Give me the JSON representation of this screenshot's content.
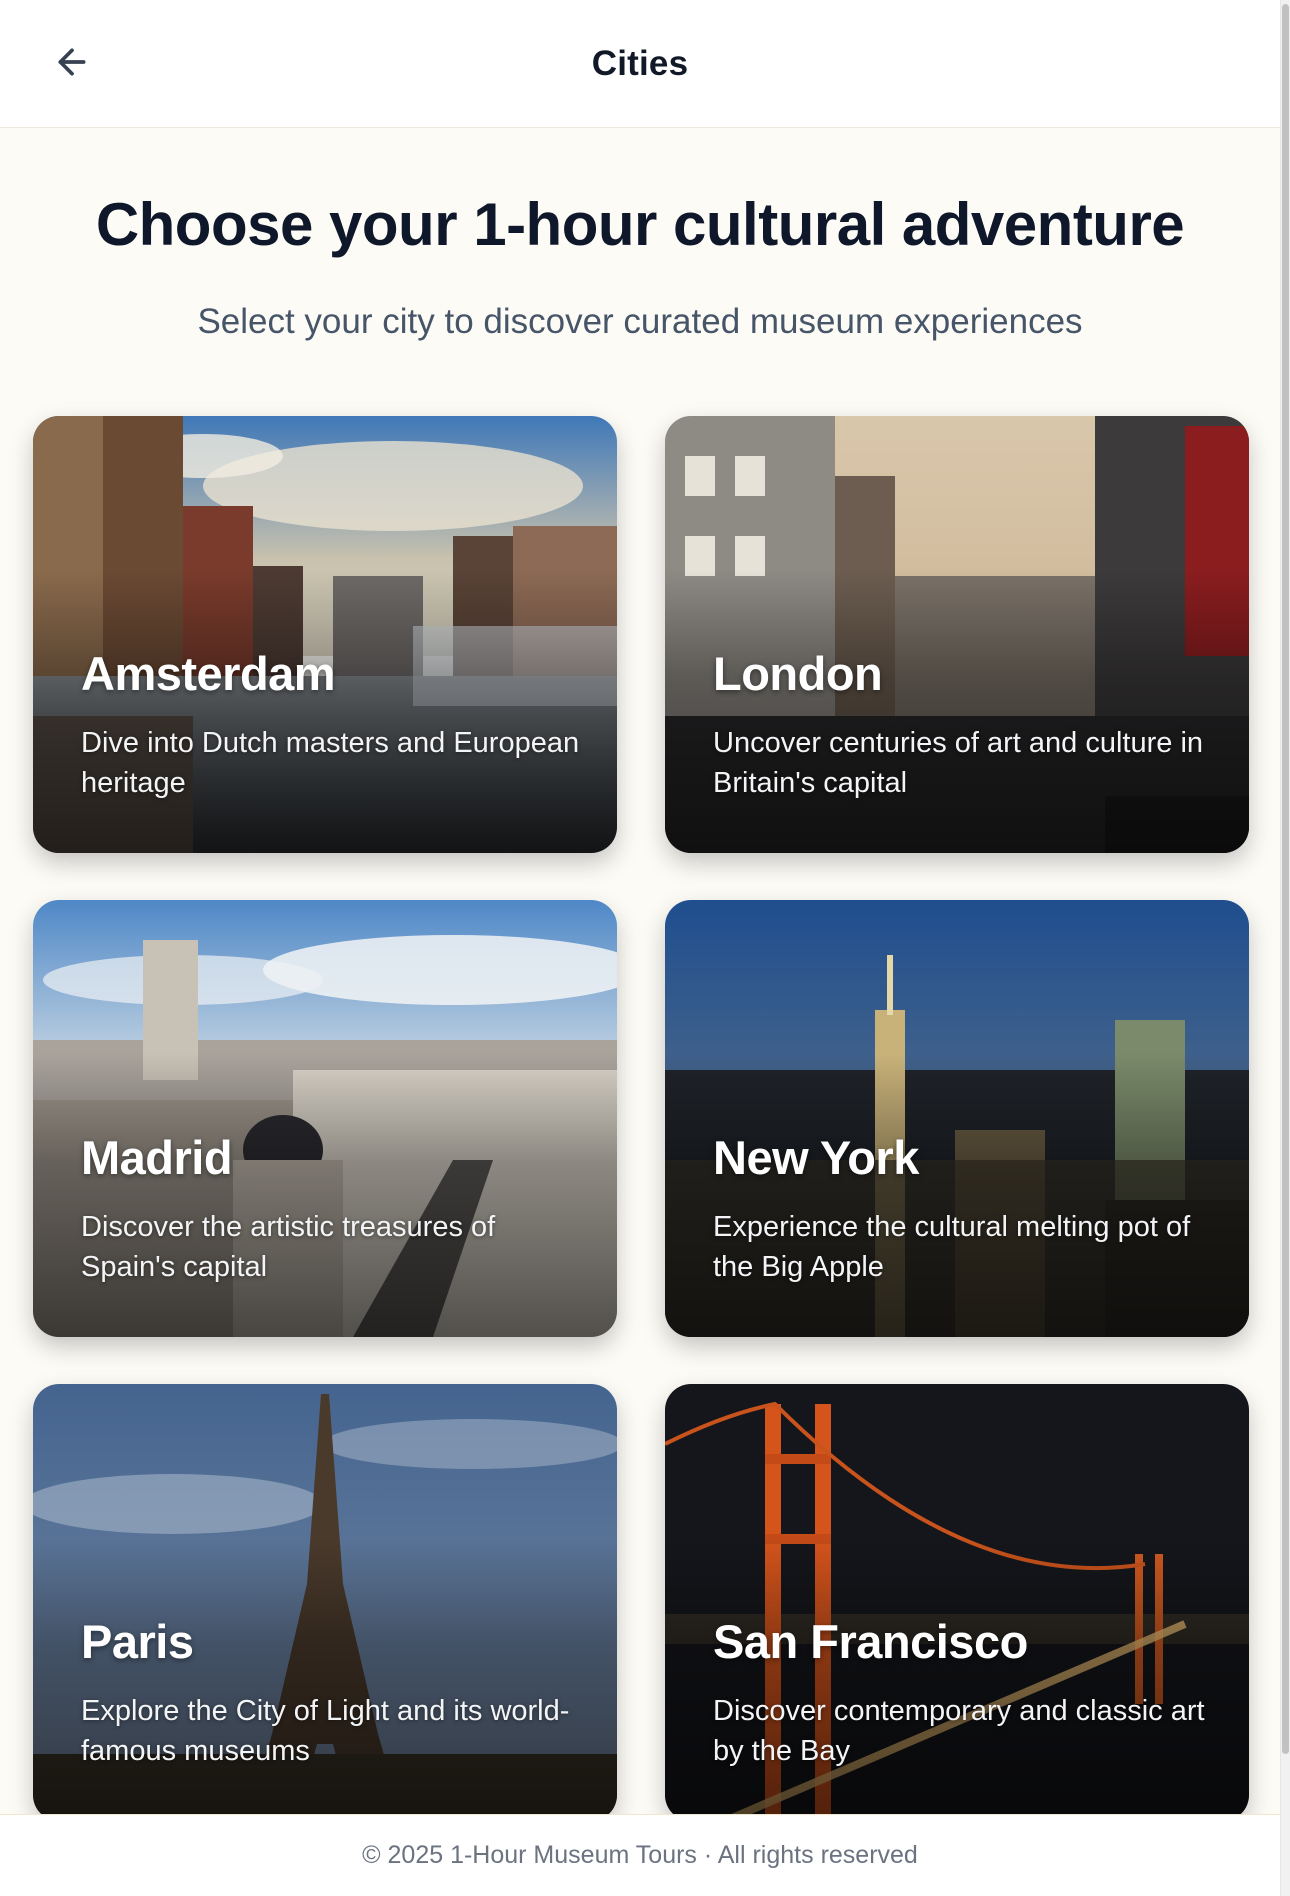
{
  "header": {
    "title": "Cities",
    "back_icon": "arrow-left-icon"
  },
  "hero": {
    "title": "Choose your 1-hour cultural adventure",
    "subtitle": "Select your city to discover curated museum experiences"
  },
  "cities": [
    {
      "name": "Amsterdam",
      "description": "Dive into Dutch masters and European heritage"
    },
    {
      "name": "London",
      "description": "Uncover centuries of art and culture in Britain's capital"
    },
    {
      "name": "Madrid",
      "description": "Discover the artistic treasures of Spain's capital"
    },
    {
      "name": "New York",
      "description": "Experience the cultural melting pot of the Big Apple"
    },
    {
      "name": "Paris",
      "description": "Explore the City of Light and its world-famous museums"
    },
    {
      "name": "San Francisco",
      "description": "Discover contemporary and classic art by the Bay"
    }
  ],
  "footer": {
    "text": "© 2025 1-Hour Museum Tours · All rights reserved"
  },
  "colors": {
    "page_background": "#fdfbf6",
    "title": "#0f172a",
    "subtitle": "#475569",
    "footer_text": "#6b7280"
  }
}
